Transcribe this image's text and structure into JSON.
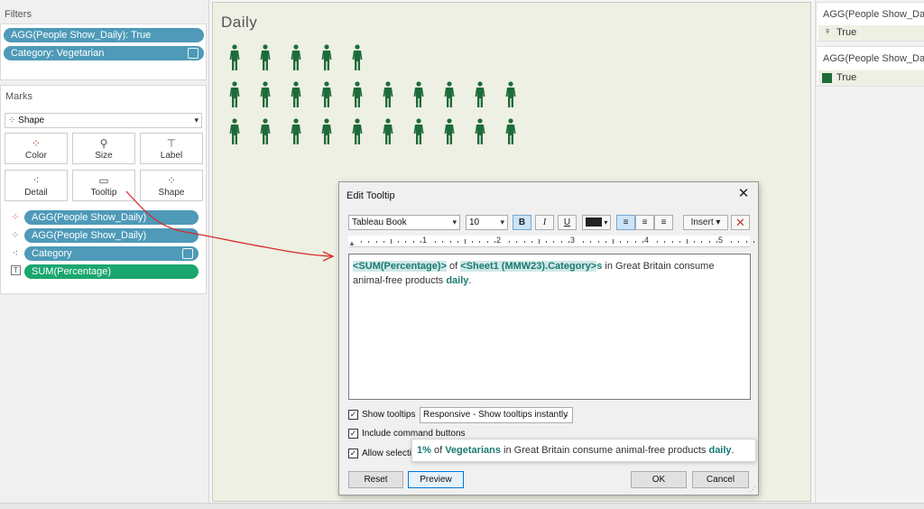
{
  "filters": {
    "title": "Filters",
    "items": [
      {
        "label": "AGG(People Show_Daily): True"
      },
      {
        "label": "Category: Vegetarian"
      }
    ]
  },
  "marks": {
    "title": "Marks",
    "type_label": "Shape",
    "buttons": {
      "color": "Color",
      "size": "Size",
      "label": "Label",
      "detail": "Detail",
      "tooltip": "Tooltip",
      "shape": "Shape"
    },
    "pills": [
      {
        "label": "AGG(People Show_Daily)",
        "icon": "color-dots-icon"
      },
      {
        "label": "AGG(People Show_Daily)",
        "icon": "shape-icon"
      },
      {
        "label": "Category",
        "icon": "detail-icon"
      },
      {
        "label": "SUM(Percentage)",
        "icon": "text-icon"
      }
    ]
  },
  "viz": {
    "title": "Daily",
    "rows": [
      5,
      10,
      10
    ],
    "color": "#1e6b3a"
  },
  "legend": {
    "shape": {
      "title": "AGG(People Show_Daily)",
      "item": "True"
    },
    "color": {
      "title": "AGG(People Show_Daily)",
      "item": "True",
      "swatch": "#1e6b3a"
    }
  },
  "dialog": {
    "title": "Edit Tooltip",
    "font": "Tableau Book",
    "size": "10",
    "bold": "B",
    "italic": "I",
    "underline": "U",
    "insert": "Insert ▾",
    "ruler": [
      "1",
      "2",
      "3",
      "4",
      "5"
    ],
    "editor": {
      "field1": "<SUM(Percentage)>",
      "t1": " of ",
      "field2": "<Sheet1 (MMW23).Category>",
      "t2": "s",
      "t3": " in Great Britain consume animal-free products ",
      "t4": "daily",
      "t5": "."
    },
    "show_tooltips": "Show tooltips",
    "tooltip_mode": "Responsive - Show tooltips instantly",
    "include_command": "Include command buttons",
    "allow_selection": "Allow selectio",
    "reset": "Reset",
    "preview": "Preview",
    "ok": "OK",
    "cancel": "Cancel"
  },
  "preview_tip": {
    "pct": "1%",
    "t1": " of ",
    "cat": "Vegetarians",
    "t2": " in Great Britain consume animal-free products ",
    "daily": "daily",
    "t3": "."
  },
  "colors": {
    "accent_pill": "#4e9ab8",
    "measure_pill": "#1aa66f",
    "field_teal": "#1a7a74",
    "annotation": "#d62b2b"
  }
}
